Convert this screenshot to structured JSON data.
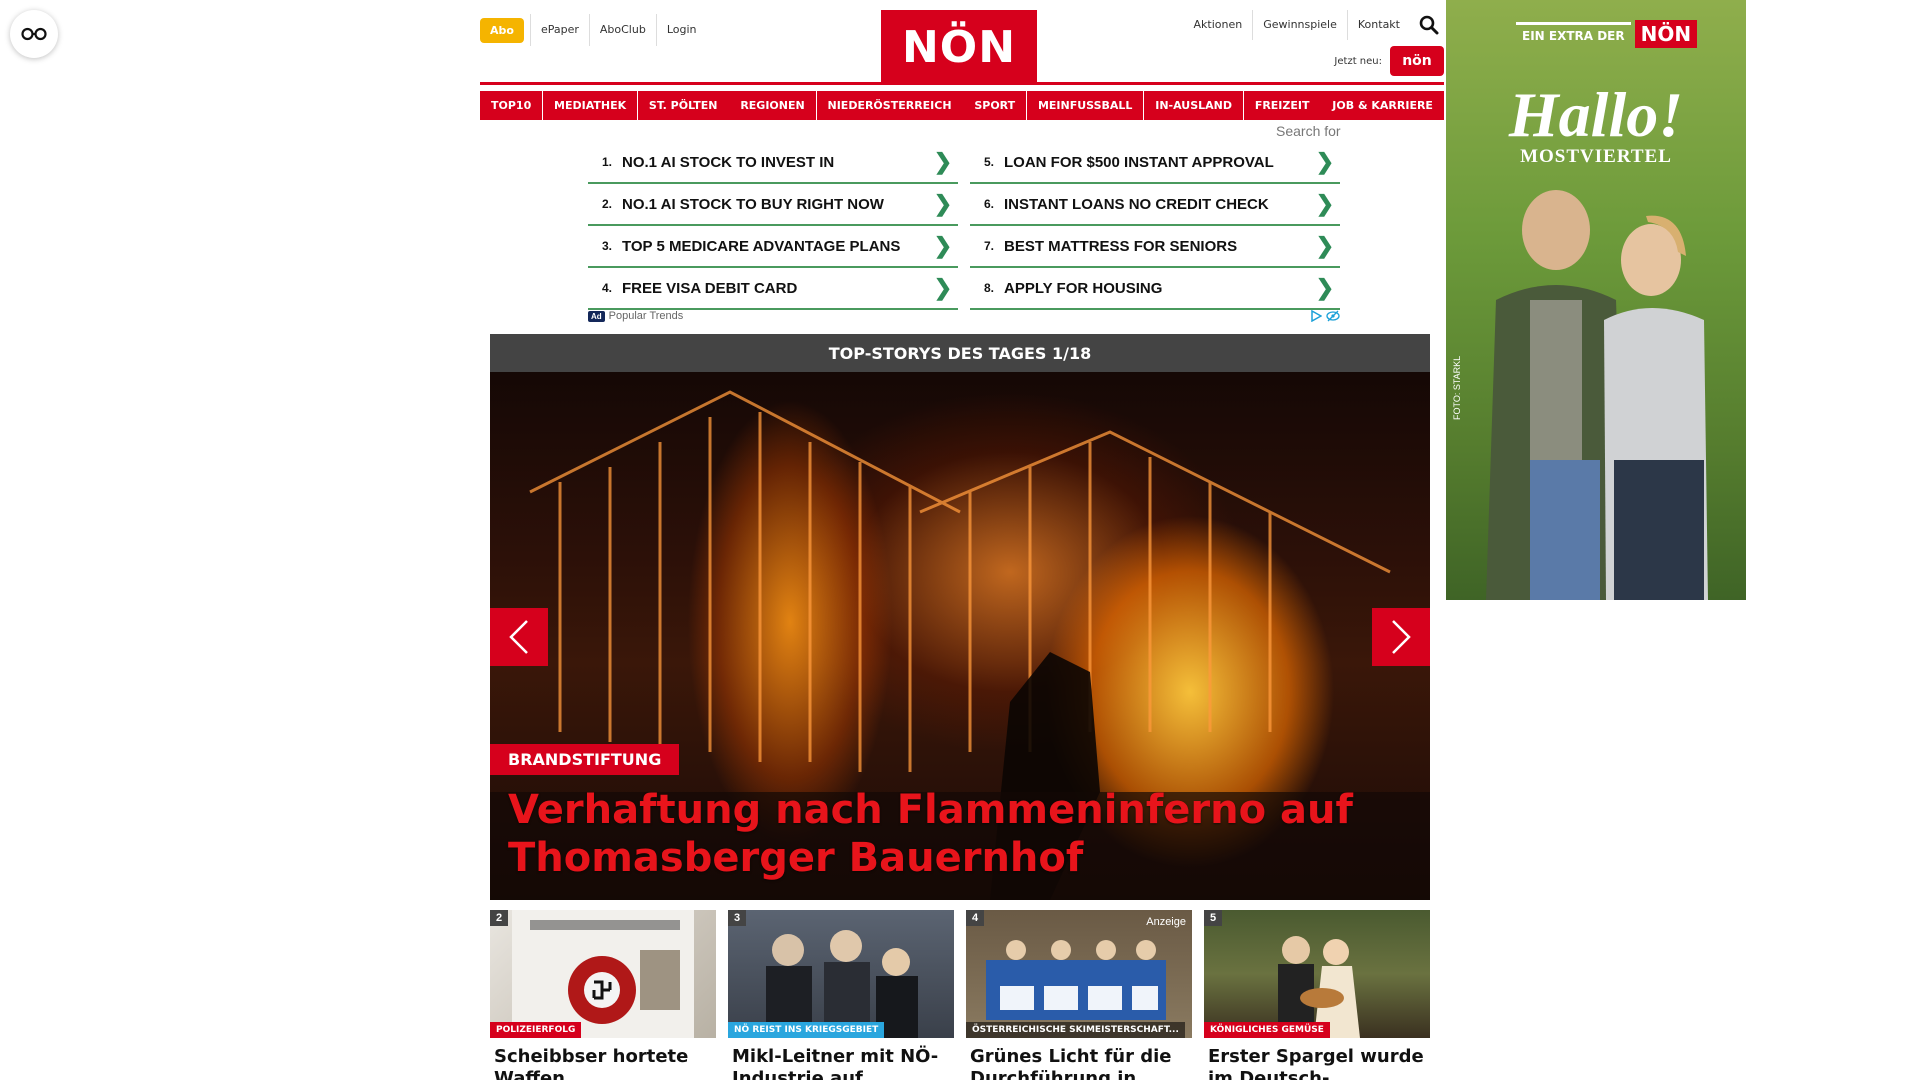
{
  "colors": {
    "brand_red": "#d6001c",
    "abo_yellow": "#f5b400",
    "ad_green": "#4a9a5e",
    "dark_header": "#444444"
  },
  "utility": {
    "abo": "Abo",
    "left_links": [
      "ePaper",
      "AboClub",
      "Login"
    ],
    "right_links": [
      "Aktionen",
      "Gewinnspiele",
      "Kontakt"
    ],
    "jetzt_label": "Jetzt neu:",
    "jetzt_logo": "nön"
  },
  "logo": {
    "text": "NÖN"
  },
  "nav": [
    "TOP10",
    "MEDIATHEK",
    "ST. PÖLTEN",
    "REGIONEN",
    "NIEDERÖSTERREICH",
    "SPORT",
    "MEINFUSSBALL",
    "IN-AUSLAND",
    "FREIZEIT",
    "JOB & KARRIERE"
  ],
  "ads": {
    "search_for": "Search for",
    "left": [
      {
        "num": "1.",
        "text": "NO.1 AI STOCK TO INVEST IN"
      },
      {
        "num": "2.",
        "text": "NO.1 AI STOCK TO BUY RIGHT NOW"
      },
      {
        "num": "3.",
        "text": "TOP 5 MEDICARE ADVANTAGE PLANS"
      },
      {
        "num": "4.",
        "text": "FREE VISA DEBIT CARD"
      }
    ],
    "right": [
      {
        "num": "5.",
        "text": "LOAN FOR $500 INSTANT APPROVAL"
      },
      {
        "num": "6.",
        "text": "INSTANT LOANS NO CREDIT CHECK"
      },
      {
        "num": "7.",
        "text": "BEST MATTRESS FOR SENIORS"
      },
      {
        "num": "8.",
        "text": "APPLY FOR HOUSING"
      }
    ],
    "chevron": "❯",
    "badge": "Ad",
    "source": "Popular Trends"
  },
  "top_stories": {
    "header": "TOP-STORYS DES TAGES 1/18",
    "hero_kicker": "BRANDSTIFTUNG",
    "hero_title": "Verhaftung nach Flammeninferno auf Thomasberger Bauernhof"
  },
  "teasers": [
    {
      "num": "2",
      "kicker": "POLIZEIERFOLG",
      "kicker_color": "#d6001c",
      "title": "Scheibbser hortete Waffen, Kriegsmaterial",
      "anzeige": ""
    },
    {
      "num": "3",
      "kicker": "NÖ REIST INS KRIEGSGEBIET",
      "kicker_color": "#2aa6de",
      "title": "Mikl-Leitner mit NÖ-Industrie auf",
      "anzeige": ""
    },
    {
      "num": "4",
      "kicker": "ÖSTERREICHISCHE SKIMEISTERSCHAFT...",
      "kicker_color": "rgba(0,0,0,0.55)",
      "title": "Grünes Licht für die Durchführung in",
      "anzeige": "Anzeige"
    },
    {
      "num": "5",
      "kicker": "KÖNIGLICHES GEMÜSE",
      "kicker_color": "#d6001c",
      "title": "Erster Spargel wurde im Deutsch-Wagramer",
      "anzeige": ""
    }
  ],
  "side_ad": {
    "badge_text": "EIN EXTRA DER",
    "badge_logo": "NÖN",
    "headline": "Hallo!",
    "subline": "MOSTVIERTEL",
    "credit": "FOTO: STARKL"
  }
}
